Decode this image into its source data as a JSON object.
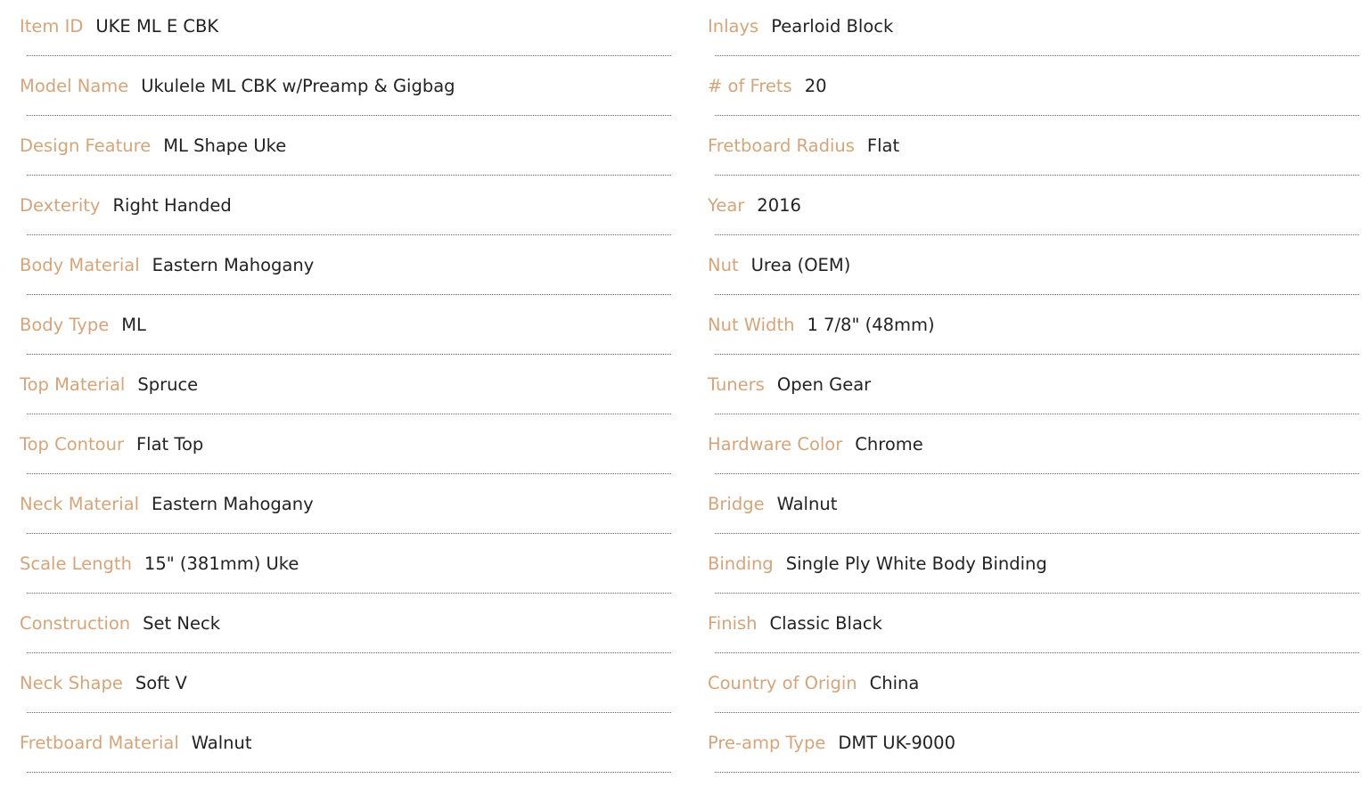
{
  "colors": {
    "label": "#d3a57c",
    "value": "#222222",
    "divider": "#666666",
    "background": "#ffffff"
  },
  "left_column": [
    {
      "label": "Item ID",
      "value": "UKE ML E CBK"
    },
    {
      "label": "Model Name",
      "value": "Ukulele ML CBK w/Preamp & Gigbag"
    },
    {
      "label": "Design Feature",
      "value": "ML Shape Uke"
    },
    {
      "label": "Dexterity",
      "value": "Right Handed"
    },
    {
      "label": "Body Material",
      "value": "Eastern Mahogany"
    },
    {
      "label": "Body Type",
      "value": "ML"
    },
    {
      "label": "Top Material",
      "value": "Spruce"
    },
    {
      "label": "Top Contour",
      "value": "Flat Top"
    },
    {
      "label": "Neck Material",
      "value": "Eastern Mahogany"
    },
    {
      "label": "Scale Length",
      "value": "15\" (381mm) Uke"
    },
    {
      "label": "Construction",
      "value": "Set Neck"
    },
    {
      "label": "Neck Shape",
      "value": "Soft V"
    },
    {
      "label": "Fretboard Material",
      "value": "Walnut"
    }
  ],
  "right_column": [
    {
      "label": "Inlays",
      "value": "Pearloid Block"
    },
    {
      "label": "# of Frets",
      "value": "20"
    },
    {
      "label": "Fretboard Radius",
      "value": "Flat"
    },
    {
      "label": "Year",
      "value": "2016"
    },
    {
      "label": "Nut",
      "value": "Urea (OEM)"
    },
    {
      "label": "Nut Width",
      "value": "1 7/8\" (48mm)"
    },
    {
      "label": "Tuners",
      "value": "Open Gear"
    },
    {
      "label": "Hardware Color",
      "value": "Chrome"
    },
    {
      "label": "Bridge",
      "value": "Walnut"
    },
    {
      "label": "Binding",
      "value": "Single Ply White Body Binding"
    },
    {
      "label": "Finish",
      "value": "Classic Black"
    },
    {
      "label": "Country of Origin",
      "value": "China"
    },
    {
      "label": "Pre-amp Type",
      "value": "DMT UK-9000"
    }
  ]
}
